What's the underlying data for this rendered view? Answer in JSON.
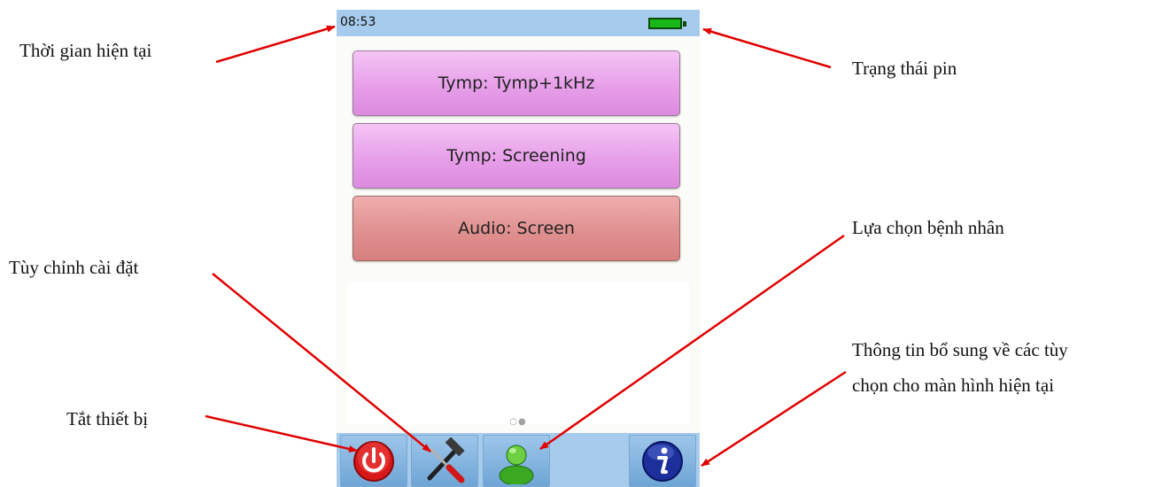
{
  "status_bar": {
    "time": "08:53"
  },
  "protocols": [
    {
      "label": "Tymp: Tymp+1kHz"
    },
    {
      "label": "Tymp: Screening"
    },
    {
      "label": "Audio: Screen"
    }
  ],
  "page_indicator": "○●",
  "toolbar": {
    "power_icon": "power-icon",
    "settings_icon": "hammer-screwdriver-icon",
    "patient_icon": "person-icon",
    "info_icon": "info-icon"
  },
  "annotations": {
    "current_time": "Thời gian hiện tại",
    "battery_status": "Trạng thái pin",
    "settings": "Tùy chỉnh cài đặt",
    "patient_select": "Lựa chọn bệnh nhân",
    "info_line1": "Thông tin bổ sung về các tùy",
    "info_line2": "chọn cho màn hình hiện tại",
    "power_off": "Tắt thiết bị"
  },
  "colors": {
    "status_bar": "#a7cbec",
    "pink_button": "#e79fe9",
    "red_button": "#e09090",
    "arrow": "#e00000"
  }
}
